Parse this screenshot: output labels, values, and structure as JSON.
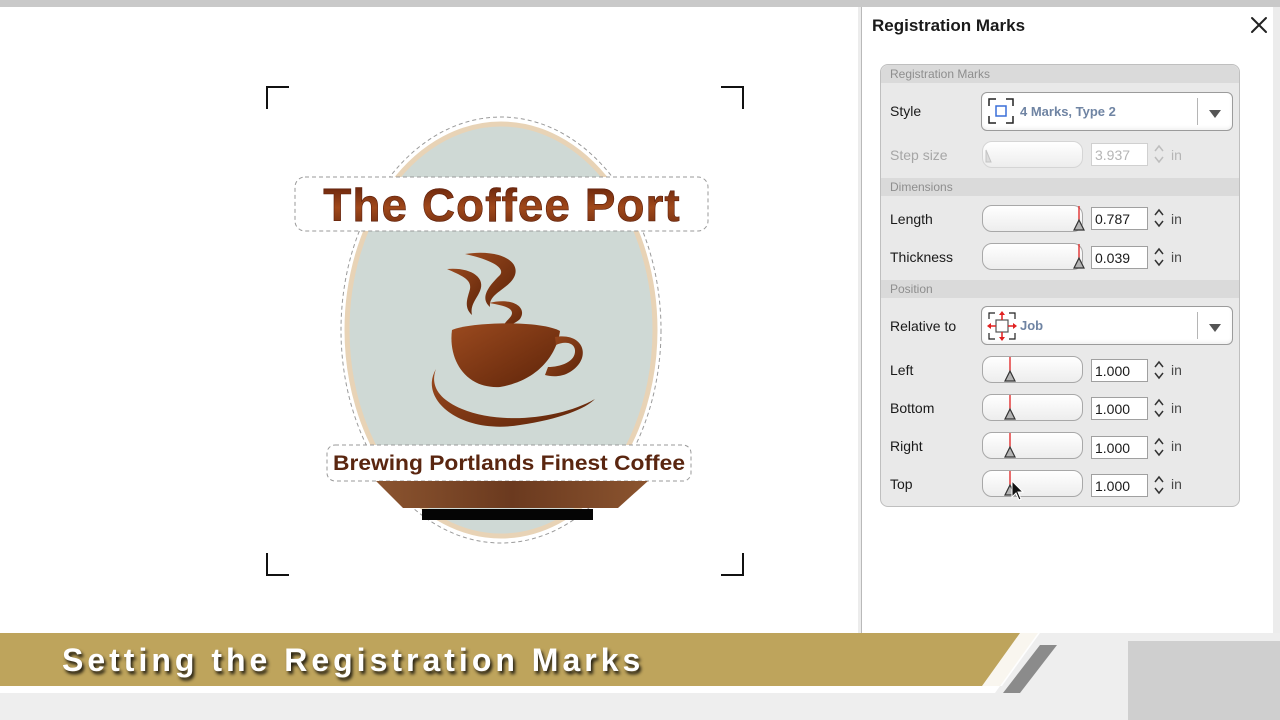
{
  "panel": {
    "title": "Registration Marks",
    "close_icon": "close-icon",
    "sections": {
      "registration_marks": "Registration Marks",
      "dimensions": "Dimensions",
      "position": "Position"
    },
    "style": {
      "label": "Style",
      "value": "4 Marks, Type 2",
      "icon": "registration-marks-type2-icon"
    },
    "step_size": {
      "label": "Step size",
      "value": "3.937",
      "unit": "in",
      "enabled": false
    },
    "length": {
      "label": "Length",
      "value": "0.787",
      "unit": "in"
    },
    "thickness": {
      "label": "Thickness",
      "value": "0.039",
      "unit": "in"
    },
    "relative_to": {
      "label": "Relative to",
      "value": "Job",
      "icon": "relative-to-job-icon"
    },
    "left": {
      "label": "Left",
      "value": "1.000",
      "unit": "in"
    },
    "bottom": {
      "label": "Bottom",
      "value": "1.000",
      "unit": "in"
    },
    "right": {
      "label": "Right",
      "value": "1.000",
      "unit": "in"
    },
    "top": {
      "label": "Top",
      "value": "1.000",
      "unit": "in"
    }
  },
  "artwork": {
    "headline": "The Coffee Port",
    "tagline": "Brewing Portlands Finest Coffee",
    "colors": {
      "oval": "#cfd9d5",
      "oval_border": "#e8d3b6",
      "coffee": "#8a3d18",
      "saucer_band": "#7a4a2c"
    }
  },
  "banner": {
    "text": "Setting the Registration Marks",
    "color": "#bea45c"
  }
}
